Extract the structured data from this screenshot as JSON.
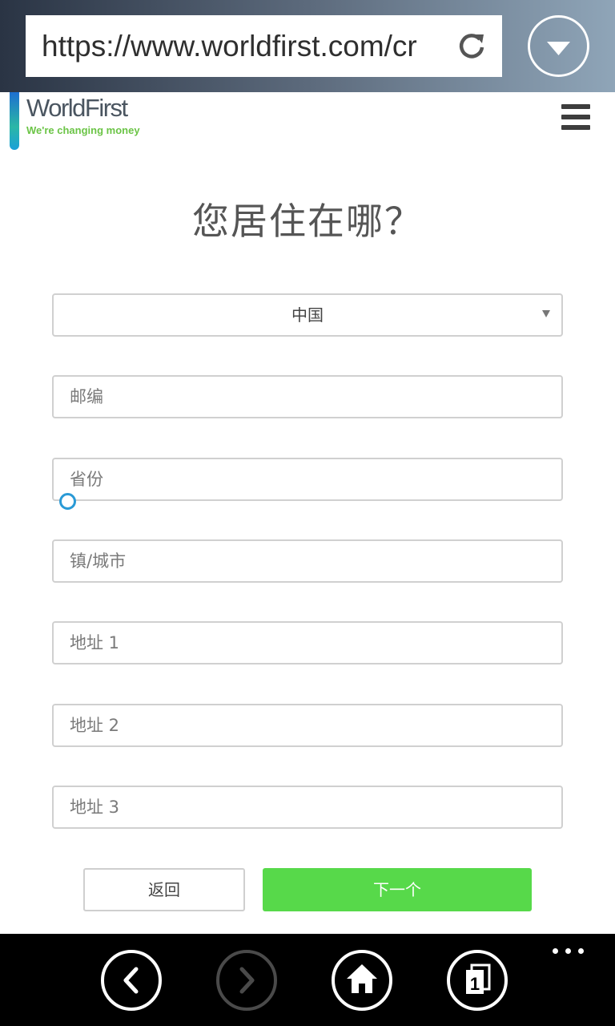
{
  "browser": {
    "url": "https://www.worldfirst.com/cr",
    "refresh_icon": "refresh-icon",
    "dropdown_icon": "chevron-down-icon"
  },
  "header": {
    "logo_name": "WorldFirst",
    "logo_tagline": "We're changing money",
    "menu_icon": "hamburger-menu-icon"
  },
  "form": {
    "title": "您居住在哪？",
    "country_selected": "中国",
    "postcode_placeholder": "邮编",
    "province_placeholder": "省份",
    "city_placeholder": "镇/城市",
    "address1_placeholder": "地址 1",
    "address2_placeholder": "地址 2",
    "address3_placeholder": "地址 3",
    "back_label": "返回",
    "next_label": "下一个"
  },
  "appbar": {
    "icons": [
      "back-icon",
      "forward-icon",
      "home-icon",
      "tabs-icon",
      "more-icon"
    ],
    "tabs_count": "1"
  },
  "colors": {
    "accent_green": "#57d94a",
    "cursor_blue": "#2a9ad6",
    "logo_tag_green": "#6bc446"
  }
}
